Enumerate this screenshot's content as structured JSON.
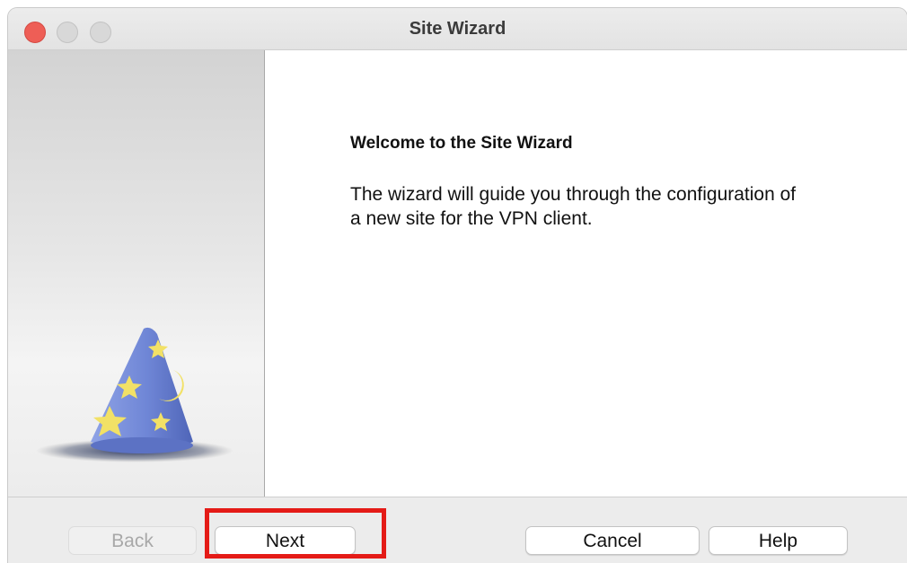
{
  "window": {
    "title": "Site Wizard",
    "controls": [
      "close",
      "minimize",
      "maximize"
    ]
  },
  "sidebar": {
    "illustration_icon": "wizard-hat-icon"
  },
  "content": {
    "heading": "Welcome to the Site Wizard",
    "description": "The wizard will guide you through the configuration of a new site for the VPN client."
  },
  "buttons": {
    "back": "Back",
    "next": "Next",
    "cancel": "Cancel",
    "help": "Help"
  },
  "states": {
    "back_disabled": true,
    "next_highlighted": true
  },
  "colors": {
    "close_button": "#ee5e56",
    "highlight_box": "#e41b17",
    "hat_blue": "#6f86d6",
    "hat_stars": "#f2e166"
  }
}
